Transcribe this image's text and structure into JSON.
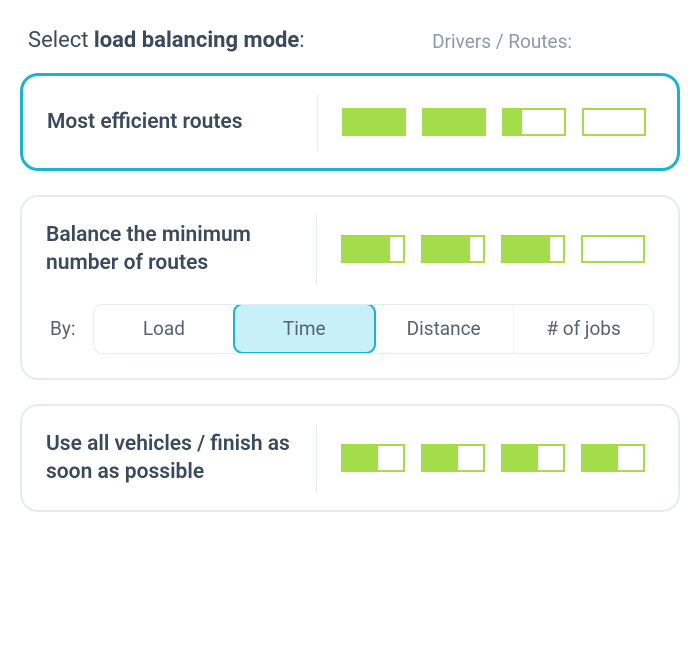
{
  "header": {
    "title_prefix": "Select ",
    "title_bold": "load balancing mode",
    "title_suffix": ":",
    "subtitle": "Drivers / Routes:"
  },
  "options": {
    "most_efficient": {
      "label": "Most efficient routes",
      "selected": true,
      "bars": [
        100,
        100,
        30,
        0
      ]
    },
    "balance_minimum": {
      "label": "Balance the minimum number of routes",
      "selected": false,
      "bars": [
        78,
        78,
        78,
        0
      ],
      "by_label": "By:",
      "by_options": [
        "Load",
        "Time",
        "Distance",
        "# of jobs"
      ],
      "by_active": "Time"
    },
    "use_all": {
      "label": "Use all vehicles / finish as soon as possible",
      "selected": false,
      "bars": [
        58,
        58,
        58,
        58
      ]
    }
  },
  "colors": {
    "accent": "#19b3d3",
    "bar_fill": "#a4dd4b",
    "seg_active_bg": "#c8f0f8"
  }
}
